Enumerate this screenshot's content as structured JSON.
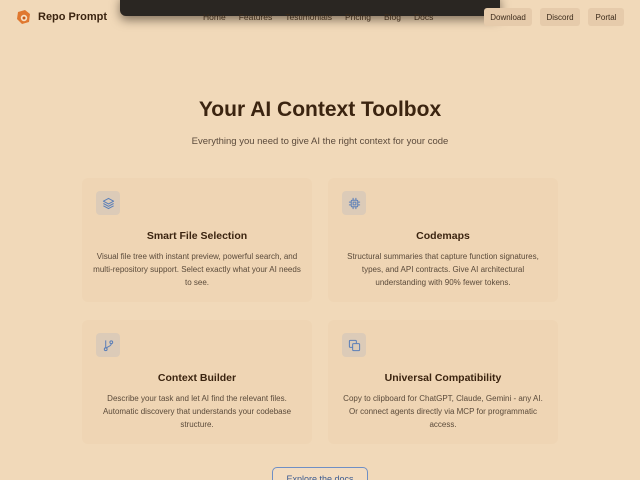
{
  "brand": {
    "name": "Repo Prompt",
    "logo_icon": "repo-prompt-logo-icon"
  },
  "nav": {
    "links": [
      "Home",
      "Features",
      "Testimonials",
      "Pricing",
      "Blog",
      "Docs"
    ],
    "download_label": "Download",
    "discord_label": "Discord",
    "portal_label": "Portal"
  },
  "hero": {
    "title": "Your AI Context Toolbox",
    "subtitle": "Everything you need to give AI the right context for your code"
  },
  "features": [
    {
      "icon": "layers-icon",
      "title": "Smart File Selection",
      "description": "Visual file tree with instant preview, powerful search, and multi-repository support. Select exactly what your AI needs to see."
    },
    {
      "icon": "cpu-chip-icon",
      "title": "Codemaps",
      "description": "Structural summaries that capture function signatures, types, and API contracts. Give AI architectural understanding with 90% fewer tokens."
    },
    {
      "icon": "git-branch-icon",
      "title": "Context Builder",
      "description": "Describe your task and let AI find the relevant files. Automatic discovery that understands your codebase structure."
    },
    {
      "icon": "copy-icon",
      "title": "Universal Compatibility",
      "description": "Copy to clipboard for ChatGPT, Claude, Gemini - any AI. Or connect agents directly via MCP for programmatic access."
    }
  ],
  "cta": {
    "label": "Explore the docs"
  },
  "colors": {
    "background": "#f1d9b9",
    "card": "#efd5b4",
    "icon_tint": "#5b7fb8",
    "text_dark": "#3b2410"
  }
}
